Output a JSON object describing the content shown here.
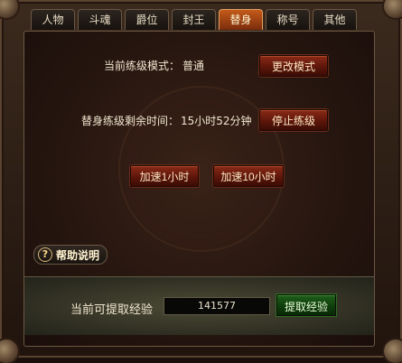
{
  "tabs": [
    {
      "label": "人物"
    },
    {
      "label": "斗魂"
    },
    {
      "label": "爵位"
    },
    {
      "label": "封王"
    },
    {
      "label": "替身",
      "active": true
    },
    {
      "label": "称号"
    },
    {
      "label": "其他"
    }
  ],
  "training_mode": {
    "label": "当前练级模式：",
    "value": "普通",
    "change_button": "更改模式"
  },
  "remaining_time": {
    "label": "替身练级剩余时间：",
    "value": "15小时52分钟",
    "stop_button": "停止练级"
  },
  "speedup": {
    "one_hour": "加速1小时",
    "ten_hours": "加速10小时"
  },
  "help": {
    "icon": "question-icon",
    "glyph": "?",
    "label": "帮助说明"
  },
  "experience": {
    "label": "当前可提取经验",
    "value": "141577",
    "extract_button": "提取经验"
  },
  "colors": {
    "active_tab": "#c35a19",
    "action_button": "#6b1a0d",
    "extract_button": "#1e5d1a"
  }
}
